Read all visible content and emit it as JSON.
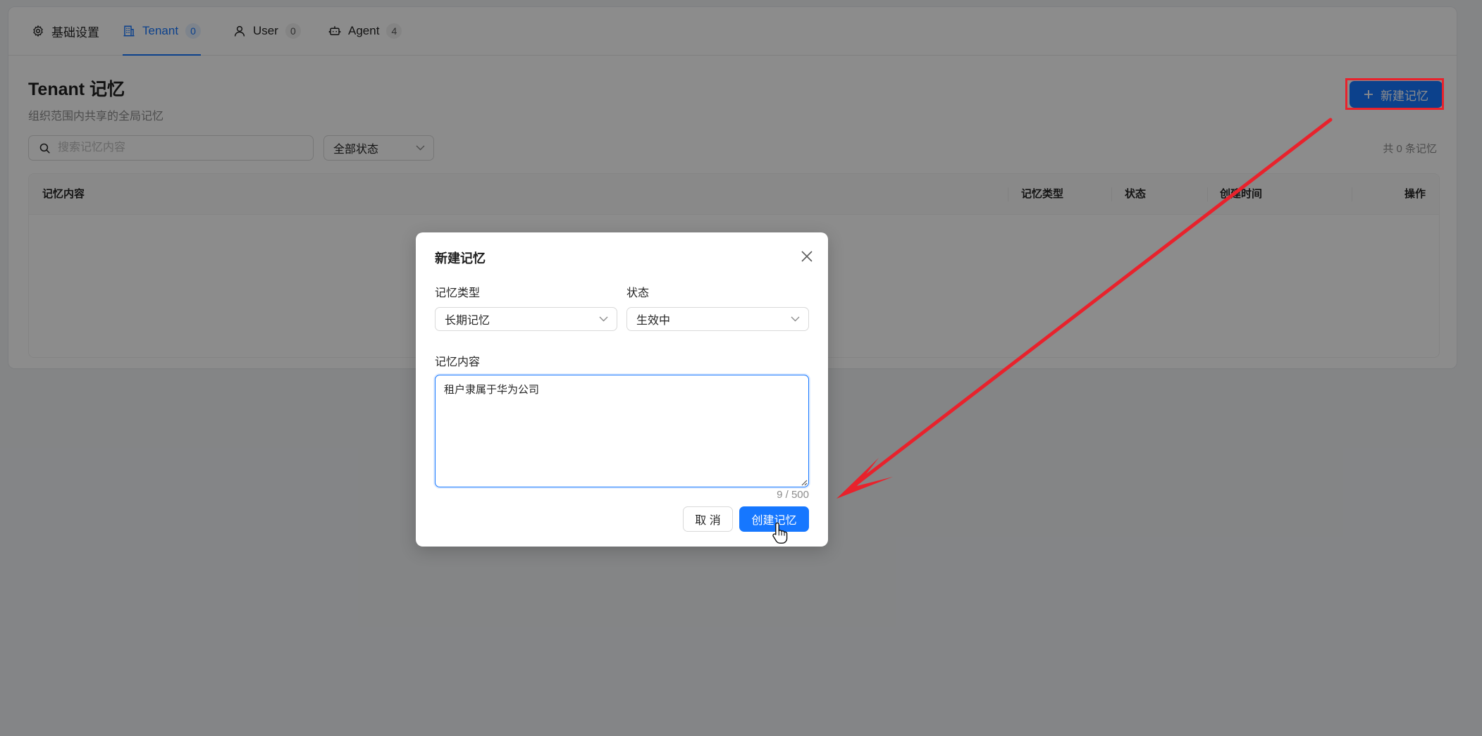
{
  "tabs": [
    {
      "label": "基础设置",
      "count": null,
      "icon": "gear-icon",
      "active": false
    },
    {
      "label": "Tenant",
      "count": "0",
      "icon": "building-icon",
      "active": true
    },
    {
      "label": "User",
      "count": "0",
      "icon": "user-icon",
      "active": false
    },
    {
      "label": "Agent",
      "count": "4",
      "icon": "robot-icon",
      "active": false
    }
  ],
  "page": {
    "title": "Tenant 记忆",
    "subtitle": "组织范围内共享的全局记忆",
    "new_button": "新建记忆"
  },
  "filters": {
    "search_placeholder": "搜索记忆内容",
    "status_filter": "全部状态",
    "count_text": "共 0 条记忆"
  },
  "table": {
    "columns": [
      "记忆内容",
      "记忆类型",
      "状态",
      "创建时间",
      "操作"
    ]
  },
  "modal": {
    "title": "新建记忆",
    "type_label": "记忆类型",
    "type_value": "长期记忆",
    "status_label": "状态",
    "status_value": "生效中",
    "content_label": "记忆内容",
    "content_value": "租户隶属于华为公司",
    "char_count": "9 / 500",
    "cancel_label": "取 消",
    "create_label": "创建记忆"
  },
  "colors": {
    "primary": "#1677ff",
    "annotation_red": "#e8222c"
  }
}
